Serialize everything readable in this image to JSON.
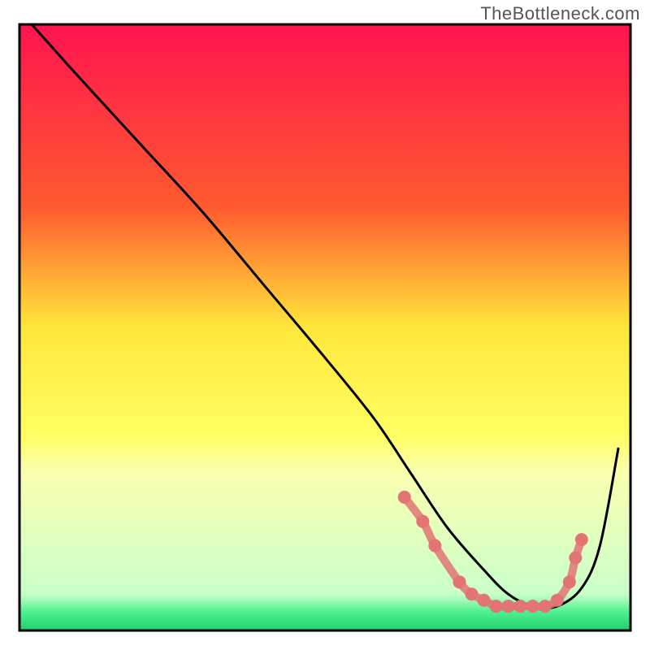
{
  "watermark": "TheBottleneck.com",
  "chart_data": {
    "type": "line",
    "title": "",
    "xlabel": "",
    "ylabel": "",
    "xlim": [
      0,
      100
    ],
    "ylim": [
      0,
      100
    ],
    "gradient_stops": [
      {
        "offset": 0,
        "color": "#ff1450"
      },
      {
        "offset": 30,
        "color": "#ff5a2f"
      },
      {
        "offset": 50,
        "color": "#ffe63a"
      },
      {
        "offset": 68,
        "color": "#ffff64"
      },
      {
        "offset": 74,
        "color": "#faffb0"
      },
      {
        "offset": 94,
        "color": "#caffca"
      },
      {
        "offset": 97,
        "color": "#4cf08c"
      },
      {
        "offset": 100,
        "color": "#20d070"
      }
    ],
    "series": [
      {
        "name": "bottleneck-curve",
        "stroke": "#000000",
        "type": "line",
        "x": [
          2,
          10,
          20,
          30,
          40,
          50,
          58,
          64,
          70,
          76,
          80,
          84,
          88,
          92,
          95,
          98
        ],
        "values": [
          100,
          91,
          80,
          69,
          57,
          45,
          35,
          26,
          17,
          10,
          6,
          4,
          4,
          7,
          14,
          30
        ]
      },
      {
        "name": "marker-dots",
        "stroke": "#e27474",
        "type": "scatter",
        "x": [
          63,
          66,
          68,
          72,
          74,
          76,
          78,
          80,
          82,
          84,
          86,
          88,
          90,
          91,
          92
        ],
        "values": [
          22,
          18,
          14,
          8,
          6,
          5,
          4,
          4,
          4,
          4,
          4,
          5,
          8,
          12,
          15
        ]
      }
    ]
  }
}
